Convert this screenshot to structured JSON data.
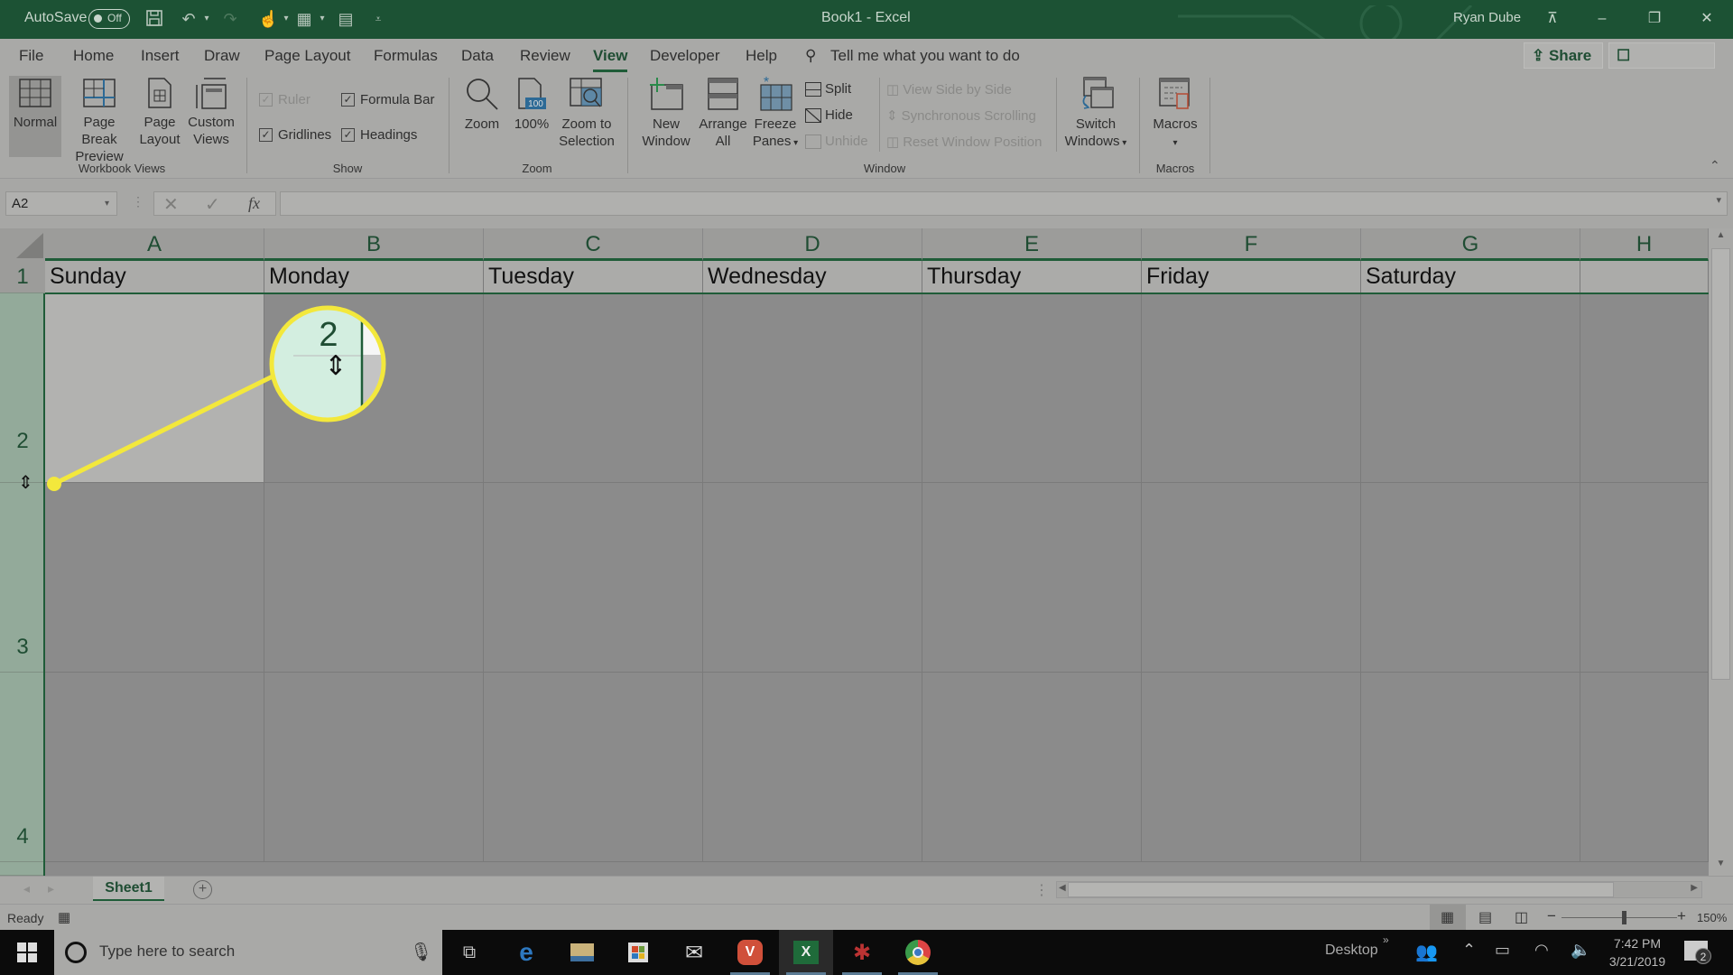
{
  "window": {
    "title": "Book1  -  Excel",
    "user": "Ryan Dube",
    "autosave_label": "AutoSave",
    "autosave_state": "Off"
  },
  "menu_tabs": [
    {
      "label": "File"
    },
    {
      "label": "Home"
    },
    {
      "label": "Insert"
    },
    {
      "label": "Draw"
    },
    {
      "label": "Page Layout"
    },
    {
      "label": "Formulas"
    },
    {
      "label": "Data"
    },
    {
      "label": "Review"
    },
    {
      "label": "View",
      "active": true
    },
    {
      "label": "Developer"
    },
    {
      "label": "Help"
    }
  ],
  "tell_me": "Tell me what you want to do",
  "share_label": "Share",
  "comments_label": "Comments",
  "ribbon": {
    "workbook_views": {
      "group_label": "Workbook Views",
      "normal": "Normal",
      "page_break_1": "Page Break",
      "page_break_2": "Preview",
      "page_layout_1": "Page",
      "page_layout_2": "Layout",
      "custom_views_1": "Custom",
      "custom_views_2": "Views"
    },
    "show": {
      "group_label": "Show",
      "ruler": "Ruler",
      "ruler_checked": true,
      "ruler_disabled": true,
      "formula_bar": "Formula Bar",
      "formula_bar_checked": true,
      "gridlines": "Gridlines",
      "gridlines_checked": true,
      "headings": "Headings",
      "headings_checked": true
    },
    "zoom": {
      "group_label": "Zoom",
      "zoom": "Zoom",
      "hundred": "100%",
      "hundred_badge": "100",
      "zoom_sel_1": "Zoom to",
      "zoom_sel_2": "Selection"
    },
    "window": {
      "group_label": "Window",
      "new_window_1": "New",
      "new_window_2": "Window",
      "arrange_1": "Arrange",
      "arrange_2": "All",
      "freeze_1": "Freeze",
      "freeze_2": "Panes",
      "split": "Split",
      "hide": "Hide",
      "unhide": "Unhide",
      "side_by_side": "View Side by Side",
      "sync_scroll": "Synchronous Scrolling",
      "reset_pos": "Reset Window Position",
      "switch_1": "Switch",
      "switch_2": "Windows"
    },
    "macros": {
      "group_label": "Macros",
      "macros": "Macros"
    }
  },
  "formula_bar": {
    "name_box": "A2",
    "formula": ""
  },
  "grid": {
    "columns": [
      "A",
      "B",
      "C",
      "D",
      "E",
      "F",
      "G",
      "H"
    ],
    "rows": [
      "1",
      "2",
      "3",
      "4"
    ],
    "row1_values": [
      "Sunday",
      "Monday",
      "Tuesday",
      "Wednesday",
      "Thursday",
      "Friday",
      "Saturday",
      ""
    ],
    "selected_cell": "A2"
  },
  "callout": {
    "magnified_text": "2",
    "color": "#f3e83c"
  },
  "sheets": [
    {
      "label": "Sheet1",
      "active": true
    }
  ],
  "status": {
    "ready": "Ready",
    "zoom_level": "150%"
  },
  "taskbar": {
    "search_placeholder": "Type here to search",
    "desktop_label": "Desktop",
    "time": "7:42 PM",
    "date": "3/21/2019",
    "notifications_count": "2"
  }
}
